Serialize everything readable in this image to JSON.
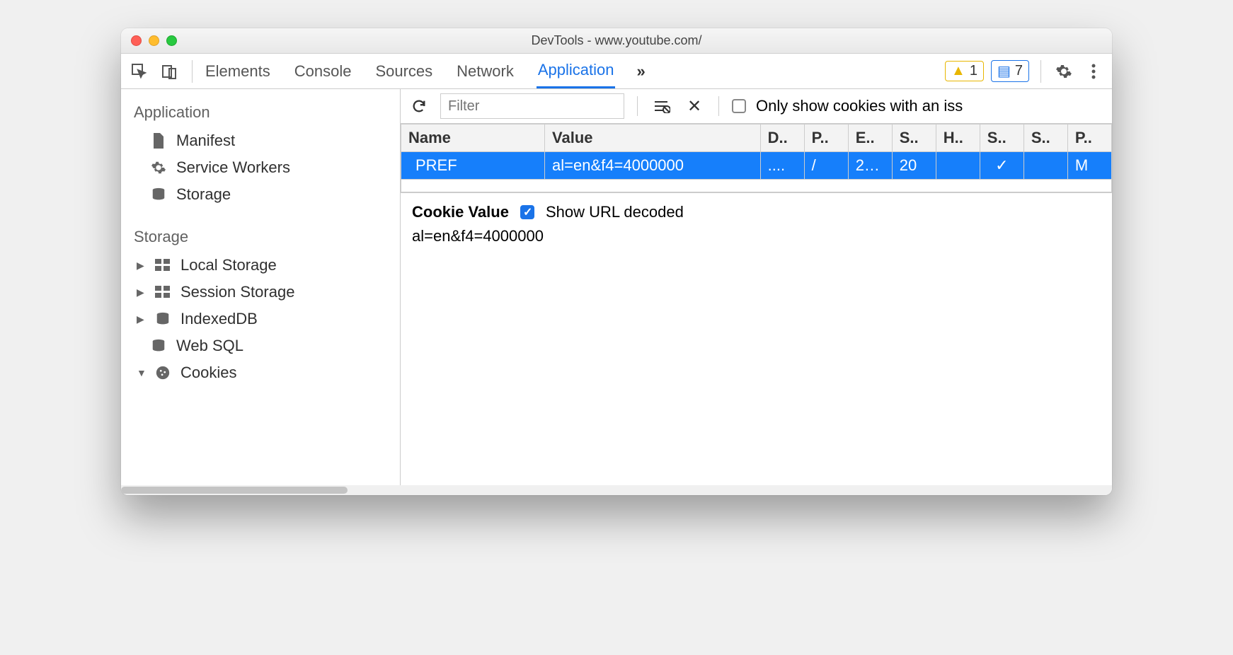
{
  "window": {
    "title": "DevTools - www.youtube.com/"
  },
  "toolbar": {
    "tabs": [
      "Elements",
      "Console",
      "Sources",
      "Network",
      "Application"
    ],
    "active_tab": "Application",
    "warn_count": "1",
    "msg_count": "7"
  },
  "sidebar": {
    "section_app": "Application",
    "app_items": [
      {
        "label": "Manifest"
      },
      {
        "label": "Service Workers"
      },
      {
        "label": "Storage"
      }
    ],
    "section_storage": "Storage",
    "storage_items": [
      {
        "label": "Local Storage",
        "expandable": true
      },
      {
        "label": "Session Storage",
        "expandable": true
      },
      {
        "label": "IndexedDB",
        "expandable": true
      },
      {
        "label": "Web SQL",
        "expandable": false
      },
      {
        "label": "Cookies",
        "expandable": true,
        "expanded": true
      }
    ]
  },
  "filterbar": {
    "placeholder": "Filter",
    "only_issues_label": "Only show cookies with an iss"
  },
  "table": {
    "headers": [
      "Name",
      "Value",
      "D..",
      "P..",
      "E..",
      "S..",
      "H..",
      "S..",
      "S..",
      "P.."
    ],
    "row": {
      "name": "PREF",
      "value": "al=en&f4=4000000",
      "domain": "....",
      "path": "/",
      "expires": "2…",
      "size": "20",
      "http": "",
      "secure": "✓",
      "samesite": "",
      "priority": "M"
    }
  },
  "details": {
    "label": "Cookie Value",
    "decode_label": "Show URL decoded",
    "value": "al=en&f4=4000000"
  }
}
